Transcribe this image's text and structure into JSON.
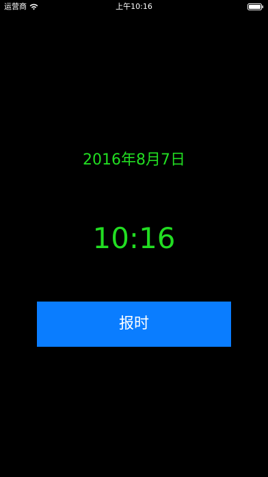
{
  "status_bar": {
    "carrier": "运营商",
    "time": "上午10:16",
    "wifi_icon": "wifi-icon",
    "battery_icon": "battery-icon"
  },
  "main": {
    "date": "2016年8月7日",
    "time": "10:16",
    "report_button_label": "报时"
  },
  "colors": {
    "background": "#000000",
    "accent_text": "#22dd22",
    "button": "#0a7dff",
    "status_text": "#ffffff"
  }
}
